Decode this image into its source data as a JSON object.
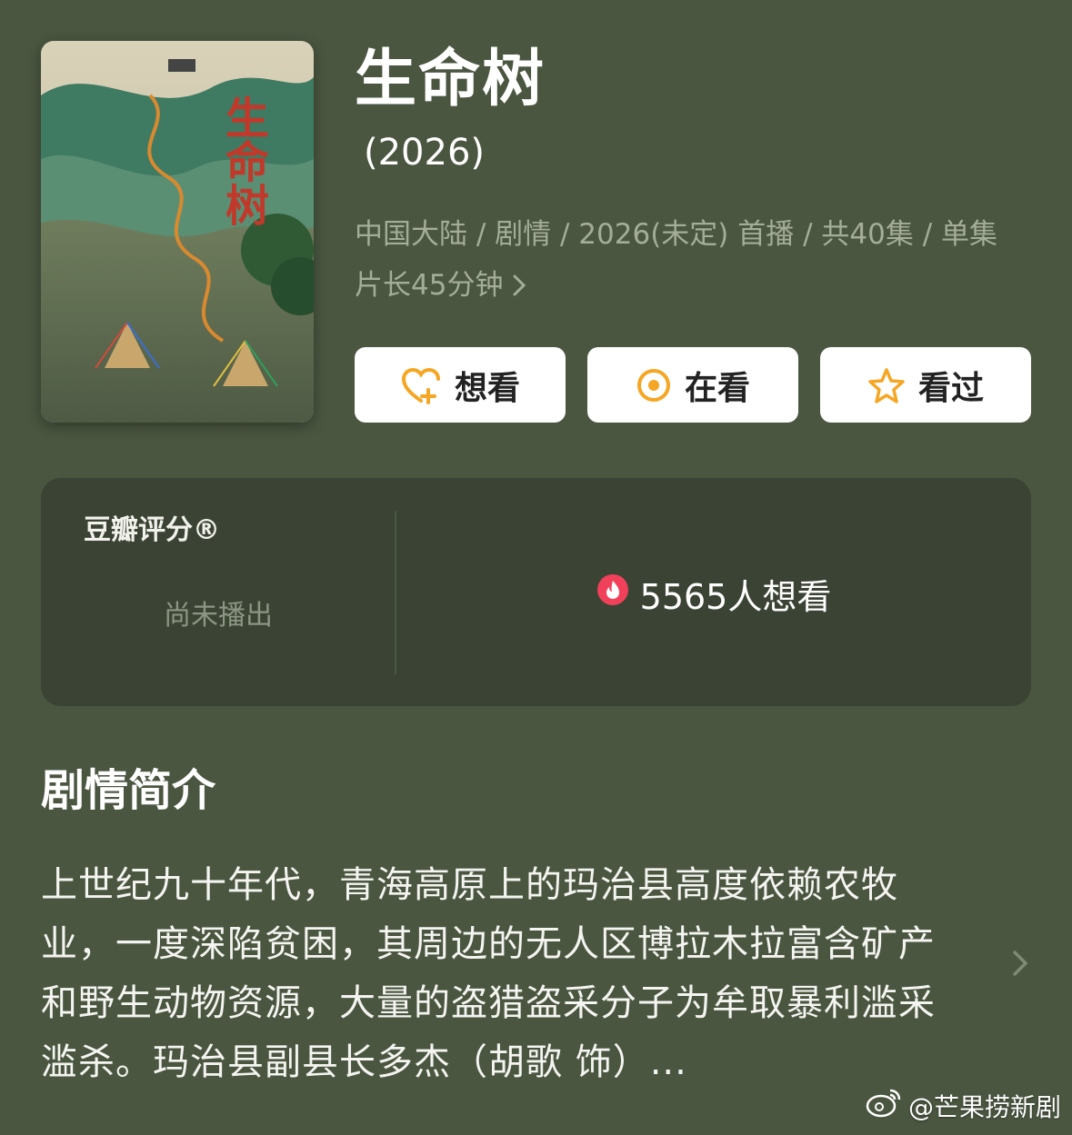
{
  "show": {
    "title": "生命树",
    "year": "(2026)",
    "meta": "中国大陆 / 剧情 / 2026(未定) 首播 / 共40集 / 单集片长45分钟",
    "poster_title": "生命树"
  },
  "actions": [
    {
      "label": "想看",
      "icon": "heart-plus-icon",
      "color": "#f5a623"
    },
    {
      "label": "在看",
      "icon": "target-circle-icon",
      "color": "#f5a623"
    },
    {
      "label": "看过",
      "icon": "star-icon",
      "color": "#f5a623"
    }
  ],
  "rating": {
    "label": "豆瓣评分®",
    "status": "尚未播出",
    "wish_count": "5565人想看",
    "wish_icon": "fire-icon",
    "wish_icon_color": "#f0405a"
  },
  "synopsis": {
    "heading": "剧情简介",
    "text": "上世纪九十年代，青海高原上的玛治县高度依赖农牧业，一度深陷贫困，其周边的无人区博拉木拉富含矿产和野生动物资源，大量的盗猎盗采分子为牟取暴利滥采滥杀。玛治县副县长多杰（胡歌 饰）..."
  },
  "watermark": {
    "text": "@芒果捞新剧",
    "icon": "weibo-icon"
  },
  "colors": {
    "background": "#4a5640",
    "card": "#3b4434",
    "accent": "#f5a623",
    "meta_text": "#a4ad98"
  }
}
